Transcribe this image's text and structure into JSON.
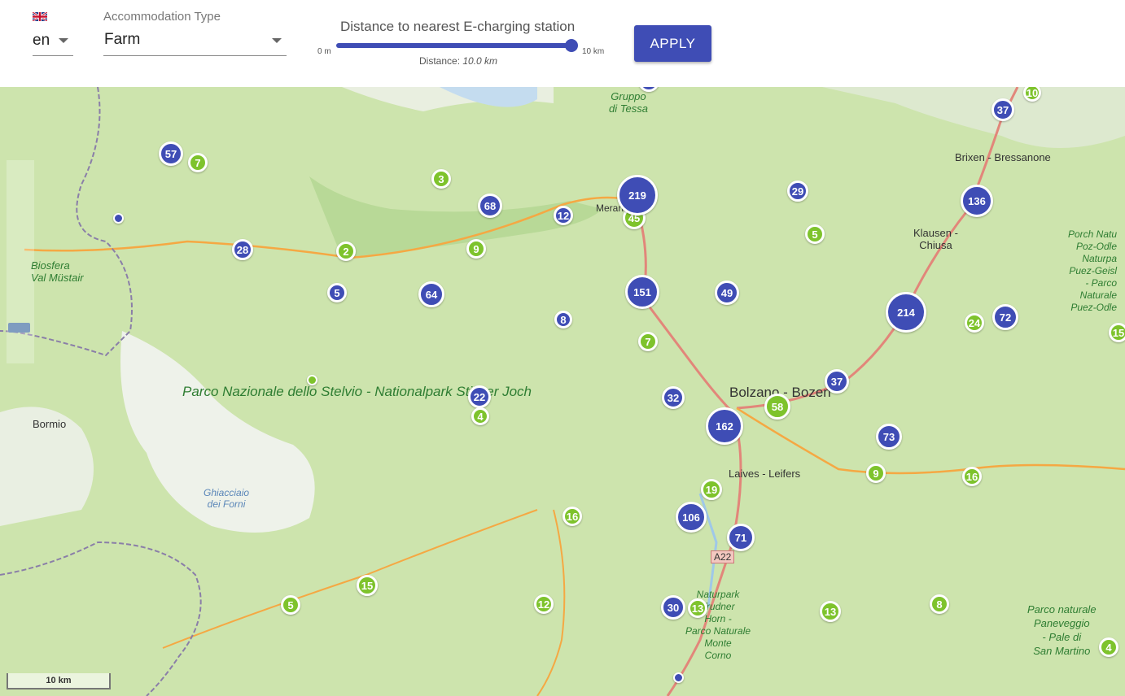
{
  "toolbar": {
    "language": "en",
    "accommodation_label": "Accommodation Type",
    "accommodation_value": "Farm",
    "distance_label": "Distance to nearest E-charging station",
    "slider_min": "0 m",
    "slider_max": "10 km",
    "distance_prefix": "Distance: ",
    "distance_value": "10.0 km",
    "distance_fraction": 1.0,
    "apply_label": "APPLY"
  },
  "map": {
    "scale_label": "10 km",
    "places": {
      "gruppo_di_tessa": "Gruppo\ndi Tessa",
      "merano": "Merano",
      "brixen": "Brixen - Bressanone",
      "klausen": "Klausen -\nChiusa",
      "biosfera": "Biosfera\nVal Müstair",
      "bormio": "Bormio",
      "stelvio": "Parco Nazionale dello Stelvio - Nationalpark Stilfser Joch",
      "ghiacciaio": "Ghiacciaio\ndei Forni",
      "bolzano": "Bolzano - Bozen",
      "laives": "Laives - Leifers",
      "a22": "A22",
      "naturpark": "Naturpark\nTrudner\nHorn -\nParco Naturale\nMonte\nCorno",
      "puez": "Porch Natu\nPoz-Odle\nNaturpa\nPuez-Geisl\n- Parco\nNaturale\nPuez-Odle",
      "paneveggio": "Parco naturale\nPaneveggio\n- Pale di\nSan Martino"
    },
    "clusters": [
      {
        "label": "57",
        "color": "blue"
      },
      {
        "label": "7",
        "color": "green"
      },
      {
        "label": "3",
        "color": "green"
      },
      {
        "label": "68",
        "color": "blue"
      },
      {
        "label": "12",
        "color": "blue"
      },
      {
        "label": "45",
        "color": "green"
      },
      {
        "label": "219",
        "color": "blue"
      },
      {
        "label": "29",
        "color": "blue"
      },
      {
        "label": "136",
        "color": "blue"
      },
      {
        "label": "37",
        "color": "blue"
      },
      {
        "label": "10",
        "color": "green"
      },
      {
        "label": "28",
        "color": "blue"
      },
      {
        "label": "2",
        "color": "green"
      },
      {
        "label": "9",
        "color": "green"
      },
      {
        "label": "5",
        "color": "green"
      },
      {
        "label": "5",
        "color": "blue"
      },
      {
        "label": "64",
        "color": "blue"
      },
      {
        "label": "151",
        "color": "blue"
      },
      {
        "label": "49",
        "color": "blue"
      },
      {
        "label": "214",
        "color": "blue"
      },
      {
        "label": "72",
        "color": "blue"
      },
      {
        "label": "24",
        "color": "green"
      },
      {
        "label": "15",
        "color": "green"
      },
      {
        "label": "8",
        "color": "blue"
      },
      {
        "label": "7",
        "color": "green"
      },
      {
        "label": "37",
        "color": "blue"
      },
      {
        "label": "22",
        "color": "blue"
      },
      {
        "label": "32",
        "color": "blue"
      },
      {
        "label": "58",
        "color": "green"
      },
      {
        "label": "4",
        "color": "green"
      },
      {
        "label": "162",
        "color": "blue"
      },
      {
        "label": "73",
        "color": "blue"
      },
      {
        "label": "9",
        "color": "green"
      },
      {
        "label": "16",
        "color": "green"
      },
      {
        "label": "19",
        "color": "green"
      },
      {
        "label": "106",
        "color": "blue"
      },
      {
        "label": "16",
        "color": "green"
      },
      {
        "label": "71",
        "color": "blue"
      },
      {
        "label": "15",
        "color": "green"
      },
      {
        "label": "5",
        "color": "green"
      },
      {
        "label": "12",
        "color": "green"
      },
      {
        "label": "30",
        "color": "blue"
      },
      {
        "label": "13",
        "color": "green"
      },
      {
        "label": "13",
        "color": "green"
      },
      {
        "label": "8",
        "color": "green"
      },
      {
        "label": "4",
        "color": "green"
      },
      {
        "label": "",
        "color": "blue"
      },
      {
        "label": "",
        "color": "green"
      },
      {
        "label": "",
        "color": "blue"
      },
      {
        "label": "",
        "color": "blue"
      }
    ]
  }
}
